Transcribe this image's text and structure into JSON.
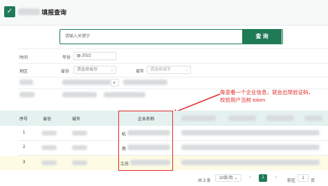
{
  "header": {
    "title": "填报查询",
    "logo_icon": "green-checkbox-icon"
  },
  "search": {
    "placeholder": "请输入关键字",
    "button": "查 询"
  },
  "filters": {
    "time_label": "时间",
    "year_label": "年份",
    "year_value": "2022",
    "region_label": "地区",
    "province_label": "省份",
    "province_placeholder": "请选择省份",
    "city_label": "城市",
    "city_placeholder": "请选择城市",
    "clear_glyph": "×"
  },
  "table": {
    "headers": [
      "序号",
      "省份",
      "城市",
      "",
      "企业名称"
    ],
    "rows": [
      {
        "index": "1",
        "company_prefix": "杭"
      },
      {
        "index": "2",
        "company_prefix": "南"
      },
      {
        "index": "3",
        "company_prefix": "江苏"
      }
    ]
  },
  "annotation": {
    "line1": "每查看一个企业信息，就会出现验证码，",
    "line2": "校验用户当前 token"
  },
  "pagination": {
    "total": "共 3 条",
    "page_size": "10条/页",
    "prev": "<",
    "current_page": "1",
    "next": ">",
    "goto_label": "前往",
    "goto_value": "1",
    "page_unit": "页"
  },
  "colors": {
    "brand": "#1f7a56",
    "annotation": "#e02a2a",
    "table_header": "#e4f1ee",
    "highlight_row": "#fdfbe4"
  }
}
